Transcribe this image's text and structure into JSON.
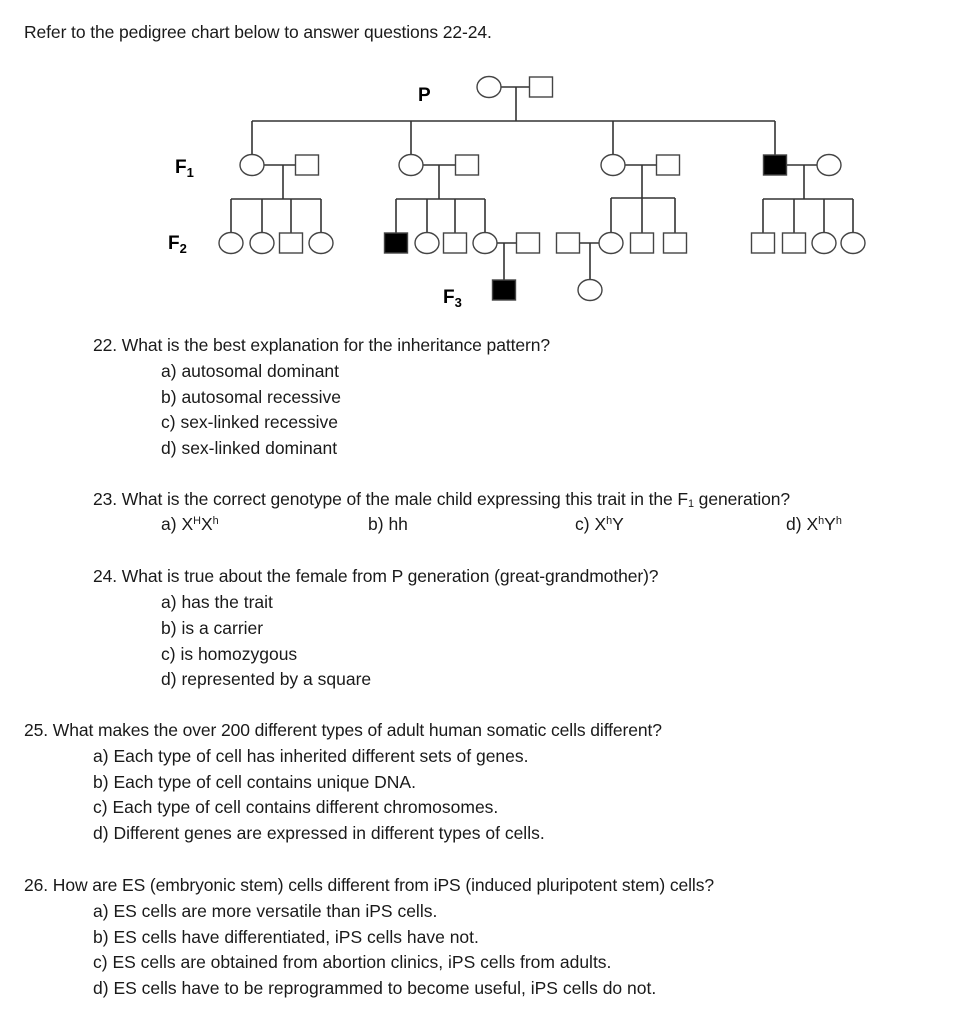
{
  "intro": "Refer to the pedigree chart below to answer questions 22-24.",
  "pedigree": {
    "generation_labels": {
      "P": "P",
      "F1": {
        "base": "F",
        "sub": "1"
      },
      "F2": {
        "base": "F",
        "sub": "2"
      },
      "F3": {
        "base": "F",
        "sub": "3"
      }
    },
    "legend_meaning": {
      "filled": "affected",
      "empty": "unaffected",
      "circle": "female",
      "square": "male"
    },
    "P": [
      {
        "sex": "female",
        "affected": false
      },
      {
        "sex": "male",
        "affected": false
      }
    ],
    "F1_couples": [
      {
        "child": {
          "sex": "female",
          "affected": false
        },
        "spouse": {
          "sex": "male",
          "affected": false
        },
        "children": [
          {
            "sex": "female",
            "affected": false
          },
          {
            "sex": "female",
            "affected": false
          },
          {
            "sex": "male",
            "affected": false
          },
          {
            "sex": "female",
            "affected": false
          }
        ]
      },
      {
        "child": {
          "sex": "female",
          "affected": false
        },
        "spouse": {
          "sex": "male",
          "affected": false
        },
        "children": [
          {
            "sex": "male",
            "affected": true
          },
          {
            "sex": "female",
            "affected": false
          },
          {
            "sex": "male",
            "affected": false
          },
          {
            "sex": "female",
            "affected": false,
            "spouse": {
              "sex": "male",
              "affected": false
            },
            "children": [
              {
                "sex": "male",
                "affected": true
              }
            ]
          }
        ]
      },
      {
        "child": {
          "sex": "female",
          "affected": false
        },
        "spouse": {
          "sex": "male",
          "affected": false
        },
        "children": [
          {
            "sex": "female",
            "affected": false,
            "spouse": {
              "sex": "male",
              "affected": false
            },
            "children": [
              {
                "sex": "female",
                "affected": false
              }
            ]
          },
          {
            "sex": "male",
            "affected": false
          },
          {
            "sex": "male",
            "affected": false
          }
        ]
      },
      {
        "child": {
          "sex": "male",
          "affected": true
        },
        "spouse": {
          "sex": "female",
          "affected": false
        },
        "children": [
          {
            "sex": "male",
            "affected": false
          },
          {
            "sex": "male",
            "affected": false
          },
          {
            "sex": "female",
            "affected": false
          },
          {
            "sex": "female",
            "affected": false
          }
        ]
      }
    ]
  },
  "questions": [
    {
      "number": "22.",
      "text": "What is the best explanation for the inheritance pattern?",
      "options": [
        {
          "letter": "a)",
          "text": "autosomal dominant"
        },
        {
          "letter": "b)",
          "text": "autosomal recessive"
        },
        {
          "letter": "c)",
          "text": "sex-linked recessive"
        },
        {
          "letter": "d)",
          "text": "sex-linked dominant"
        }
      ]
    },
    {
      "number": "23.",
      "text_before": "What is the correct genotype of the male child expressing this trait in the F",
      "text_sub": "1",
      "text_after": " generation?",
      "options": [
        {
          "letter": "a)",
          "parts": [
            {
              "t": "X"
            },
            {
              "sup": "H"
            },
            {
              "t": "X"
            },
            {
              "sup": "h"
            }
          ]
        },
        {
          "letter": "b)",
          "parts": [
            {
              "t": "hh"
            }
          ]
        },
        {
          "letter": "c)",
          "parts": [
            {
              "t": "X"
            },
            {
              "sup": "h"
            },
            {
              "t": "Y"
            }
          ]
        },
        {
          "letter": "d)",
          "parts": [
            {
              "t": "X"
            },
            {
              "sup": "h"
            },
            {
              "t": "Y"
            },
            {
              "sup": "h"
            }
          ]
        }
      ]
    },
    {
      "number": "24.",
      "text": "What is true about the female from P generation (great-grandmother)?",
      "options": [
        {
          "letter": "a)",
          "text": "has the trait"
        },
        {
          "letter": "b)",
          "text": "is a carrier"
        },
        {
          "letter": "c)",
          "text": "is homozygous"
        },
        {
          "letter": "d)",
          "text": "represented by a square"
        }
      ]
    },
    {
      "number": "25.",
      "text": "What makes the over 200 different types of adult human somatic cells different?",
      "options": [
        {
          "letter": "a)",
          "text": "Each type of cell has inherited different sets of genes."
        },
        {
          "letter": "b)",
          "text": "Each type of cell contains unique DNA."
        },
        {
          "letter": "c)",
          "text": "Each type of cell contains different chromosomes."
        },
        {
          "letter": "d)",
          "text": "Different genes are expressed in different types of cells."
        }
      ]
    },
    {
      "number": "26.",
      "text": "How are ES (embryonic stem) cells different from iPS (induced pluripotent stem) cells?",
      "options": [
        {
          "letter": "a)",
          "text": "ES cells are more versatile than iPS cells."
        },
        {
          "letter": "b)",
          "text": "ES cells have differentiated, iPS cells have not."
        },
        {
          "letter": "c)",
          "text": "ES cells are obtained from abortion clinics, iPS cells from adults."
        },
        {
          "letter": "d)",
          "text": "ES cells have to be reprogrammed to become useful, iPS cells do not."
        }
      ]
    }
  ],
  "colors": {
    "affected": "#000000",
    "unaffected": "#ffffff",
    "line": "#333333",
    "text": "#1a1a1a"
  }
}
